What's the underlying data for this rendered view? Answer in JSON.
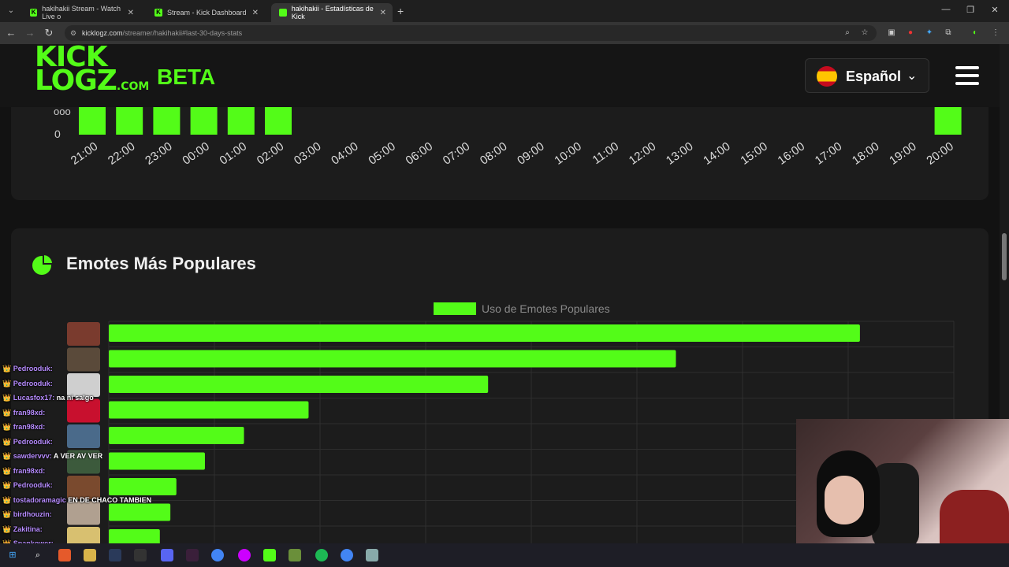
{
  "browser": {
    "tabs": [
      {
        "label": "hakihakii Stream - Watch Live o",
        "active": false
      },
      {
        "label": "Stream - Kick Dashboard",
        "active": false
      },
      {
        "label": "hakihakii - Estadísticas de Kick",
        "active": true
      }
    ],
    "url_domain": "kicklogz.com",
    "url_path": "/streamer/hakihakii#last-30-days-stats"
  },
  "site": {
    "logo_line1": "KICK",
    "logo_line2": "LOGZ",
    "logo_domain": ".COM",
    "beta": "BETA",
    "language": "Español"
  },
  "hourly_chart": {
    "zero_label": "0",
    "hours": [
      "21:00",
      "22:00",
      "23:00",
      "00:00",
      "01:00",
      "02:00",
      "03:00",
      "04:00",
      "05:00",
      "06:00",
      "07:00",
      "08:00",
      "09:00",
      "10:00",
      "11:00",
      "12:00",
      "13:00",
      "14:00",
      "15:00",
      "16:00",
      "17:00",
      "18:00",
      "19:00",
      "20:00"
    ]
  },
  "emotes_section": {
    "title": "Emotes Más Populares",
    "legend": "Uso de Emotes Populares"
  },
  "chart_data": {
    "type": "bar",
    "orientation": "horizontal",
    "series": [
      {
        "name": "Uso de Emotes Populares",
        "values": [
          100,
          75.5,
          50.5,
          26.6,
          18,
          12.8,
          9,
          8.2,
          6.8
        ]
      }
    ],
    "xlim": [
      0,
      112.5
    ],
    "grid": true,
    "legend_position": "top",
    "color": "#53fc18"
  },
  "chat": [
    {
      "user": "Pedrooduk:",
      "msg": ""
    },
    {
      "user": "Pedrooduk:",
      "msg": ""
    },
    {
      "user": "Lucasfox17:",
      "msg": "na ni salgo"
    },
    {
      "user": "fran98xd:",
      "msg": ""
    },
    {
      "user": "fran98xd:",
      "msg": ""
    },
    {
      "user": "Pedrooduk:",
      "msg": ""
    },
    {
      "user": "sawdervvv:",
      "msg": "A VER AV VER"
    },
    {
      "user": "fran98xd:",
      "msg": ""
    },
    {
      "user": "Pedrooduk:",
      "msg": ""
    },
    {
      "user": "tostadoramagic",
      "msg": "EN DE CHACO TAMBIEN"
    },
    {
      "user": "birdhouzin:",
      "msg": ""
    },
    {
      "user": "Zakitina:",
      "msg": ""
    },
    {
      "user": "Spankower:",
      "msg": ""
    }
  ],
  "colors": {
    "accent": "#53fc18",
    "background": "#121212",
    "card": "#1c1c1c"
  }
}
